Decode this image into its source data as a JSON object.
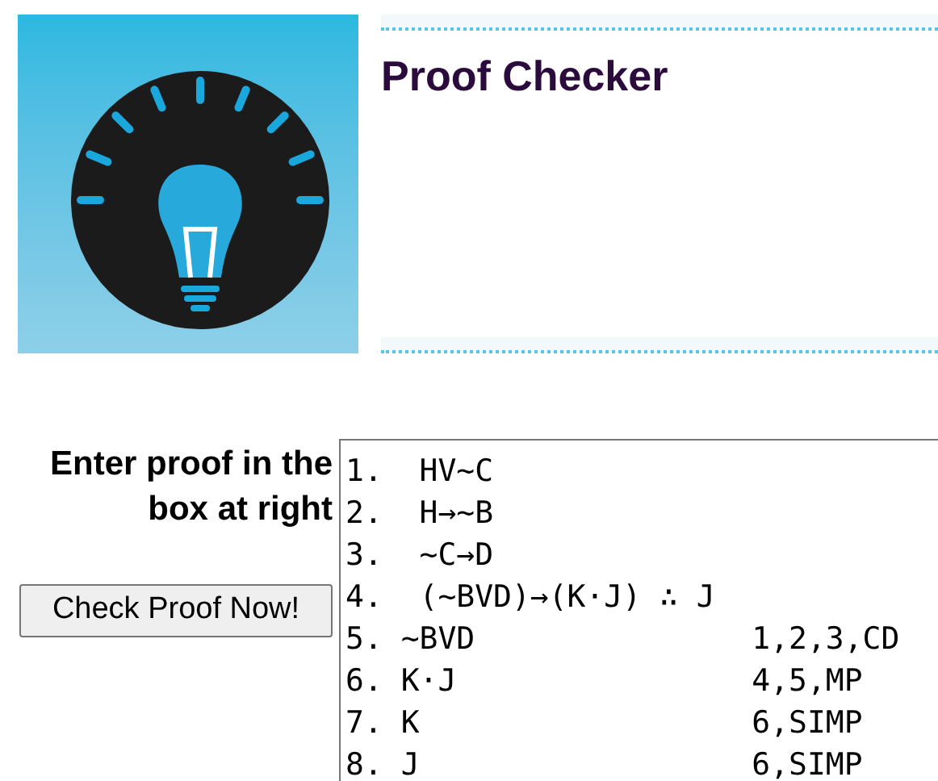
{
  "header": {
    "title": "Proof Checker"
  },
  "form": {
    "label": "Enter proof in the box at right",
    "button": "Check Proof Now!",
    "proof_lines": [
      "1.  HV~C",
      "2.  H→~B",
      "3.  ~C→D",
      "4.  (~BVD)→(K·J) ∴ J",
      "5. ~BVD               1,2,3,CD",
      "6. K·J                4,5,MP",
      "7. K                  6,SIMP",
      "8. J                  6,SIMP"
    ]
  }
}
